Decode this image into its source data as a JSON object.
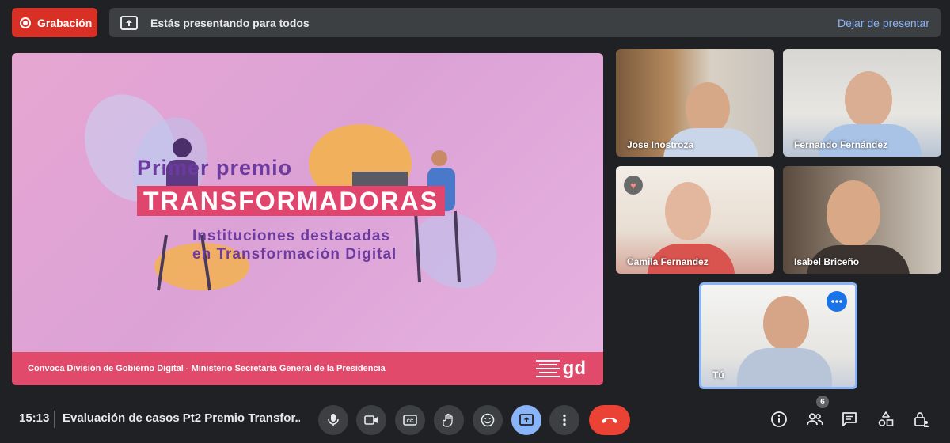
{
  "top_bar": {
    "record_label": "Grabación",
    "presenting_text": "Estás presentando para todos",
    "stop_label": "Dejar de presentar"
  },
  "slide": {
    "title_line1": "Primer premio",
    "title_line2": "TRANSFORMADORAS",
    "subtitle_line1": "Instituciones destacadas",
    "subtitle_line2": "en Transformación Digital",
    "footer": "Convoca División de Gobierno Digital - Ministerio Secretaría General de la Presidencia",
    "logo_text": "gd"
  },
  "participants": [
    {
      "name": "Jose Inostroza"
    },
    {
      "name": "Fernando Fernández"
    },
    {
      "name": "Camila Fernandez"
    },
    {
      "name": "Isabel Briceño"
    },
    {
      "name": "Tú"
    }
  ],
  "bottom_bar": {
    "time": "15:13",
    "meeting_name": "Evaluación de casos Pt2 Premio Transfor...",
    "people_count": "6"
  },
  "colors": {
    "background": "#202124",
    "record_red": "#d93025",
    "hangup_red": "#ea4335",
    "accent_blue": "#8ab4f8",
    "slide_pink": "#e14a6b",
    "slide_purple": "#6d3ba0"
  }
}
